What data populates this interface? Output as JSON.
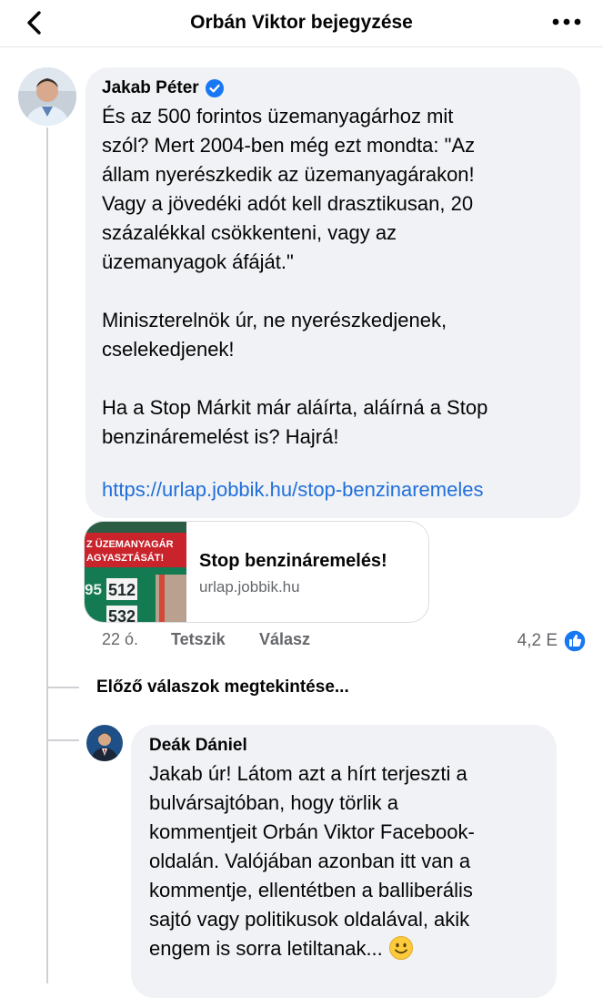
{
  "header": {
    "title": "Orbán Viktor bejegyzése"
  },
  "comment": {
    "author": "Jakab Péter",
    "verified": true,
    "text": "És az 500 forintos üzemanyagárhoz mit\nszól? Mert 2004-ben még ezt mondta: \"Az\nállam nyerészkedik az üzemanyagárakon!\nVagy a jövedéki adót kell drasztikusan, 20\nszázalékkal csökkenteni, vagy az\nüzemanyagok áfáját.\"\n\nMiniszterelnök úr, ne nyerészkedjenek,\ncselekedjenek!\n\nHa a Stop Márkit már aláírta, aláírná a Stop\nbenzináremelést is? Hajrá!",
    "link": "https://urlap.jobbik.hu/stop-benzinaremeles",
    "preview": {
      "title": "Stop benzináremelés!",
      "domain": "urlap.jobbik.hu",
      "image_banner_line1": "Z ÜZEMANYAGÁR",
      "image_banner_line2": "AGYASZTÁSÁT!",
      "image_price1_prefix": "95",
      "image_price1": "512",
      "image_price2": "532"
    },
    "time": "22 ó.",
    "like_label": "Tetszik",
    "reply_label": "Válasz",
    "reaction_count": "4,2 E"
  },
  "previous_replies_label": "Előző válaszok megtekintése...",
  "reply": {
    "author": "Deák Dániel",
    "text": "Jakab úr! Látom azt a hírt terjeszti a\nbulvársajtóban, hogy törlik a\nkommentjeit Orbán Viktor Facebook-\noldalán. Valójában azonban itt van a\nkommentje, ellentétben a balliberális\nsajtó vagy politikusok oldalával, akik\nengem is sorra letiltanak...",
    "emoji": "🙂"
  },
  "colors": {
    "accent": "#1877f2",
    "link": "#216fdb",
    "bubble": "#f0f2f5",
    "secondary_text": "#65676b"
  },
  "icons": {
    "back": "chevron-left-icon",
    "more": "more-dots-icon",
    "verified": "verified-badge-icon",
    "like": "like-reaction-icon",
    "emoji": "smile-emoji-icon"
  }
}
